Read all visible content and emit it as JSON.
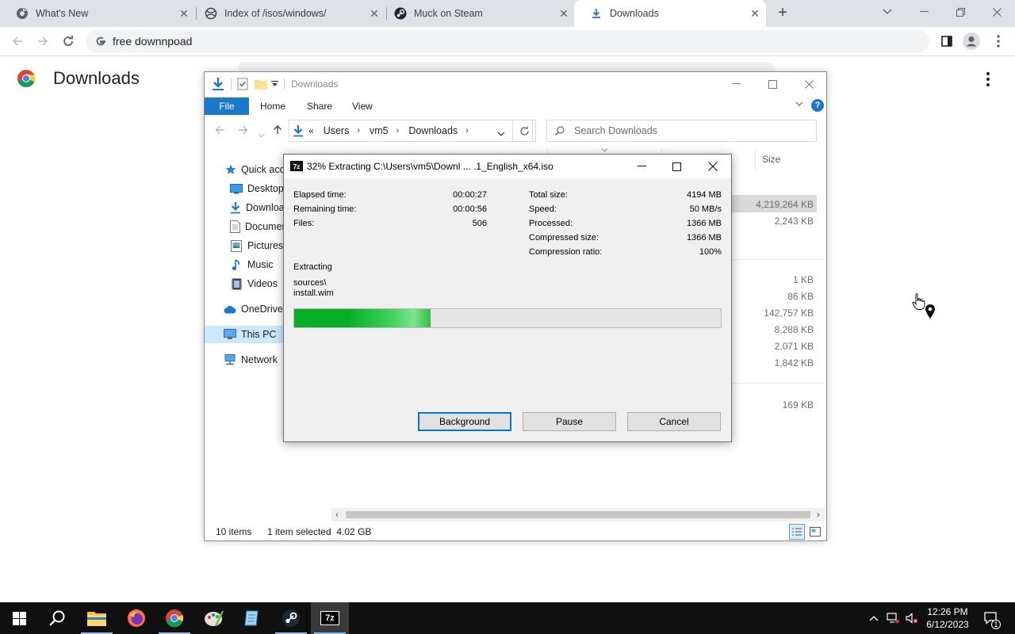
{
  "browser": {
    "tabs": [
      {
        "label": "What's New",
        "icon": "chrome-info-icon"
      },
      {
        "label": "Index of /isos/windows/",
        "icon": "globe-icon"
      },
      {
        "label": "Muck on Steam",
        "icon": "steam-icon"
      },
      {
        "label": "Downloads",
        "icon": "download-icon",
        "active": true
      }
    ],
    "omnibox_text": "free downnpoad"
  },
  "downloads_page": {
    "title": "Downloads"
  },
  "explorer": {
    "title": "Downloads",
    "ribbon_tabs": [
      "File",
      "Home",
      "Share",
      "View"
    ],
    "help_label": "?",
    "breadcrumb": {
      "prefix": "«",
      "parts": [
        "Users",
        "vm5",
        "Downloads"
      ]
    },
    "search_placeholder": "Search Downloads",
    "nav_items": [
      {
        "label": "Quick access",
        "icon": "star-icon"
      },
      {
        "label": "Desktop",
        "icon": "desktop-icon"
      },
      {
        "label": "Downloads",
        "icon": "download-icon"
      },
      {
        "label": "Documents",
        "icon": "document-icon"
      },
      {
        "label": "Pictures",
        "icon": "pictures-icon"
      },
      {
        "label": "Music",
        "icon": "music-icon"
      },
      {
        "label": "Videos",
        "icon": "video-icon"
      },
      {
        "label": "OneDrive",
        "icon": "cloud-icon"
      },
      {
        "label": "This PC",
        "icon": "computer-icon",
        "selected": true
      },
      {
        "label": "Network",
        "icon": "network-icon"
      }
    ],
    "size_column": "Size",
    "sizes": [
      "4,219,264 KB",
      "2,243 KB",
      "1 KB",
      "86 KB",
      "142,757 KB",
      "8,288 KB",
      "2,071 KB",
      "1,842 KB",
      "169 KB"
    ],
    "status": {
      "items": "10 items",
      "selection": "1 item selected  4.02 GB"
    }
  },
  "sevenzip": {
    "title": "32% Extracting C:\\Users\\vm5\\Downl ... .1_English_x64.iso",
    "progress_percent": 32,
    "left_stats": [
      {
        "label": "Elapsed time:",
        "value": "00:00:27"
      },
      {
        "label": "Remaining time:",
        "value": "00:00:56"
      },
      {
        "label": "Files:",
        "value": "506"
      }
    ],
    "right_stats": [
      {
        "label": "Total size:",
        "value": "4194 MB"
      },
      {
        "label": "Speed:",
        "value": "50 MB/s"
      },
      {
        "label": "Processed:",
        "value": "1366 MB"
      },
      {
        "label": "Compressed size:",
        "value": "1366 MB"
      },
      {
        "label": "Compression ratio:",
        "value": "100%"
      }
    ],
    "operation": "Extracting",
    "current_path": "sources\\",
    "current_file": "install.wim",
    "buttons": {
      "background": "Background",
      "pause": "Pause",
      "cancel": "Cancel"
    },
    "icon_text": "7z"
  },
  "taskbar": {
    "clock_time": "12:26 PM",
    "clock_date": "6/12/2023",
    "notification_count": "1",
    "active_app_label": "7z"
  },
  "colors": {
    "chrome_tabstrip": "#dee1e6",
    "explorer_file_tab": "#1979ca",
    "progress_green": "#06b025",
    "taskbar": "#101010"
  }
}
